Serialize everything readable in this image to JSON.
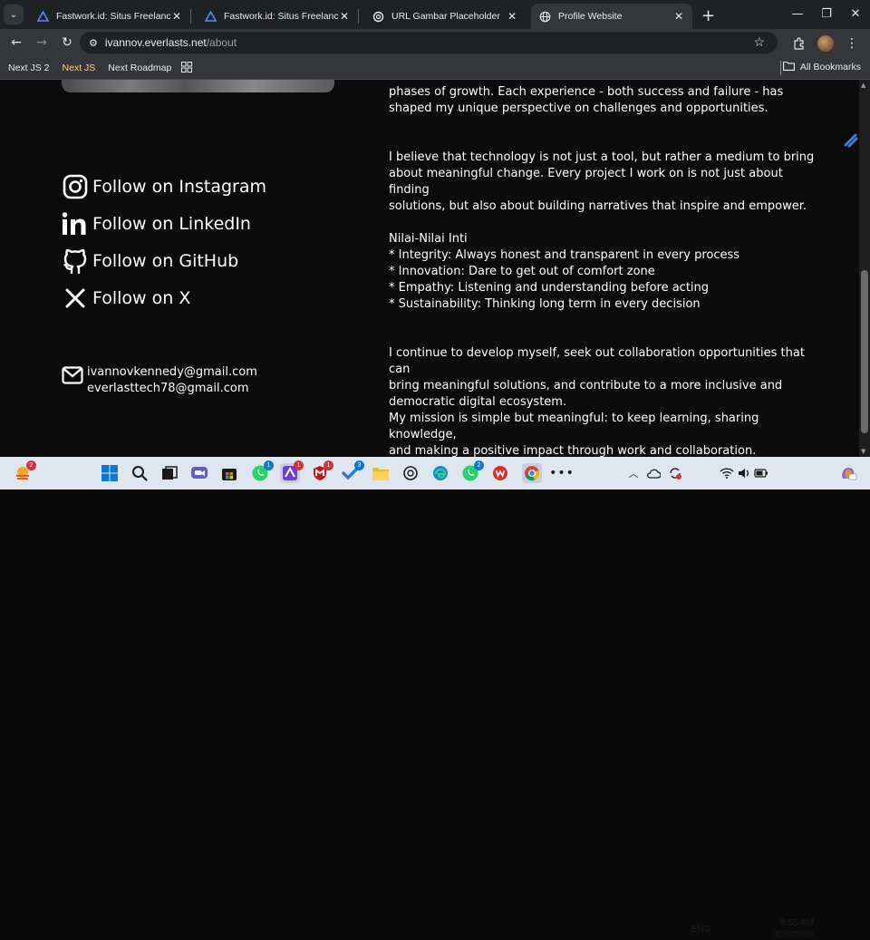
{
  "browser": {
    "tabs": [
      {
        "title": "Fastwork.id: Situs Freelance Onl",
        "icon": "fastwork-icon",
        "active": false
      },
      {
        "title": "Fastwork.id: Situs Freelance Onl",
        "icon": "fastwork-icon",
        "active": false
      },
      {
        "title": "URL Gambar Placeholder",
        "icon": "openai-icon",
        "active": false
      },
      {
        "title": "Profile Website",
        "icon": "globe-icon",
        "active": true
      }
    ],
    "url_host": "ivannov.everlasts.net",
    "url_path": "/about",
    "bookmarks": [
      "Next JS 2",
      "Next JS",
      "Next Roadmap"
    ],
    "all_bookmarks_label": "All Bookmarks"
  },
  "page": {
    "social_links": [
      {
        "label": "Follow on Instagram",
        "icon": "instagram-icon"
      },
      {
        "label": "Follow on LinkedIn",
        "icon": "linkedin-icon"
      },
      {
        "label": "Follow on GitHub",
        "icon": "github-icon"
      },
      {
        "label": "Follow on X",
        "icon": "x-icon"
      }
    ],
    "emails": [
      "ivannovkennedy@gmail.com",
      "everlasttech78@gmail.com"
    ],
    "paragraphs": {
      "p1_line1": "phases of growth. Each experience - both success and failure - has",
      "p1_line2": "shaped my unique perspective on challenges and opportunities.",
      "p2_line1": "I believe that technology is not just a tool, but rather a medium to bring",
      "p2_line2": "about meaningful change. Every project I work on is not just about finding",
      "p2_line3": "solutions, but also about building narratives that inspire and empower.",
      "values_title": "Nilai-Nilai Inti",
      "values": [
        "* Integrity: Always honest and transparent in every process",
        "* Innovation: Dare to get out of comfort zone",
        "* Empathy: Listening and understanding before acting",
        "* Sustainability: Thinking long term in every decision"
      ],
      "p4_line1": "I continue to develop myself, seek out collaboration opportunities that can",
      "p4_line2": "bring meaningful solutions, and contribute to a more inclusive and",
      "p4_line3": "democratic digital ecosystem.",
      "p5_line1": "My mission is simple but meaningful: to keep learning, sharing knowledge,",
      "p5_line2": "and making a positive impact through work and collaboration."
    }
  },
  "taskbar": {
    "badges": {
      "weather": "2",
      "app_purple": "1",
      "mcafee": "1",
      "todo": "3",
      "whatsapp1": "1",
      "whatsapp2": "2"
    },
    "language": "ENG",
    "time": "9:55 AM",
    "date": "3/26/2025"
  },
  "colors": {
    "accent_yellow": "#fdd663",
    "page_bg": "#0b0b0b",
    "taskbar_bg": "#dfe6f0"
  }
}
